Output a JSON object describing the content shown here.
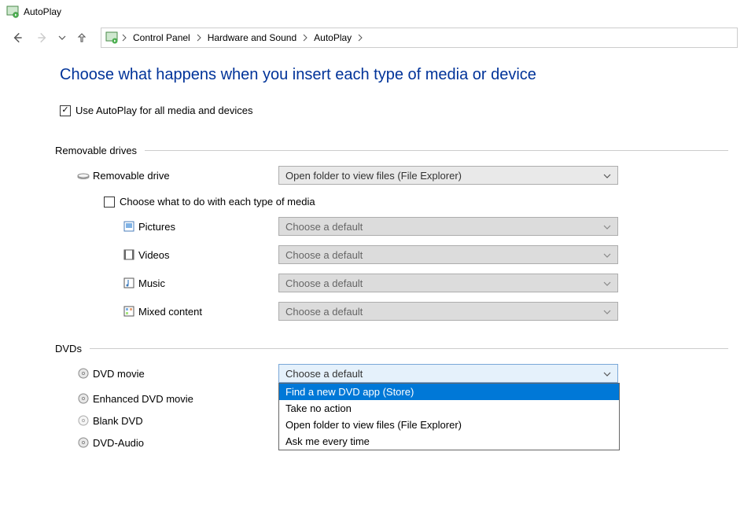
{
  "window": {
    "title": "AutoPlay"
  },
  "breadcrumbs": {
    "items": [
      "Control Panel",
      "Hardware and Sound",
      "AutoPlay"
    ]
  },
  "page": {
    "heading": "Choose what happens when you insert each type of media or device",
    "global_checkbox_label": "Use AutoPlay for all media and devices",
    "global_checkbox_checked": true
  },
  "groups": {
    "removable": {
      "title": "Removable drives",
      "drive_label": "Removable drive",
      "drive_value": "Open folder to view files (File Explorer)",
      "subcheck_label": "Choose what to do with each type of media",
      "subcheck_checked": false,
      "media": {
        "pictures": {
          "label": "Pictures",
          "value": "Choose a default"
        },
        "videos": {
          "label": "Videos",
          "value": "Choose a default"
        },
        "music": {
          "label": "Music",
          "value": "Choose a default"
        },
        "mixed": {
          "label": "Mixed content",
          "value": "Choose a default"
        }
      }
    },
    "dvds": {
      "title": "DVDs",
      "items": {
        "movie": {
          "label": "DVD movie",
          "value": "Choose a default"
        },
        "enhanced": {
          "label": "Enhanced DVD movie"
        },
        "blank": {
          "label": "Blank DVD"
        },
        "audio": {
          "label": "DVD-Audio"
        }
      },
      "open_dropdown_options": [
        "Find a new DVD app (Store)",
        "Take no action",
        "Open folder to view files (File Explorer)",
        "Ask me every time"
      ]
    }
  }
}
